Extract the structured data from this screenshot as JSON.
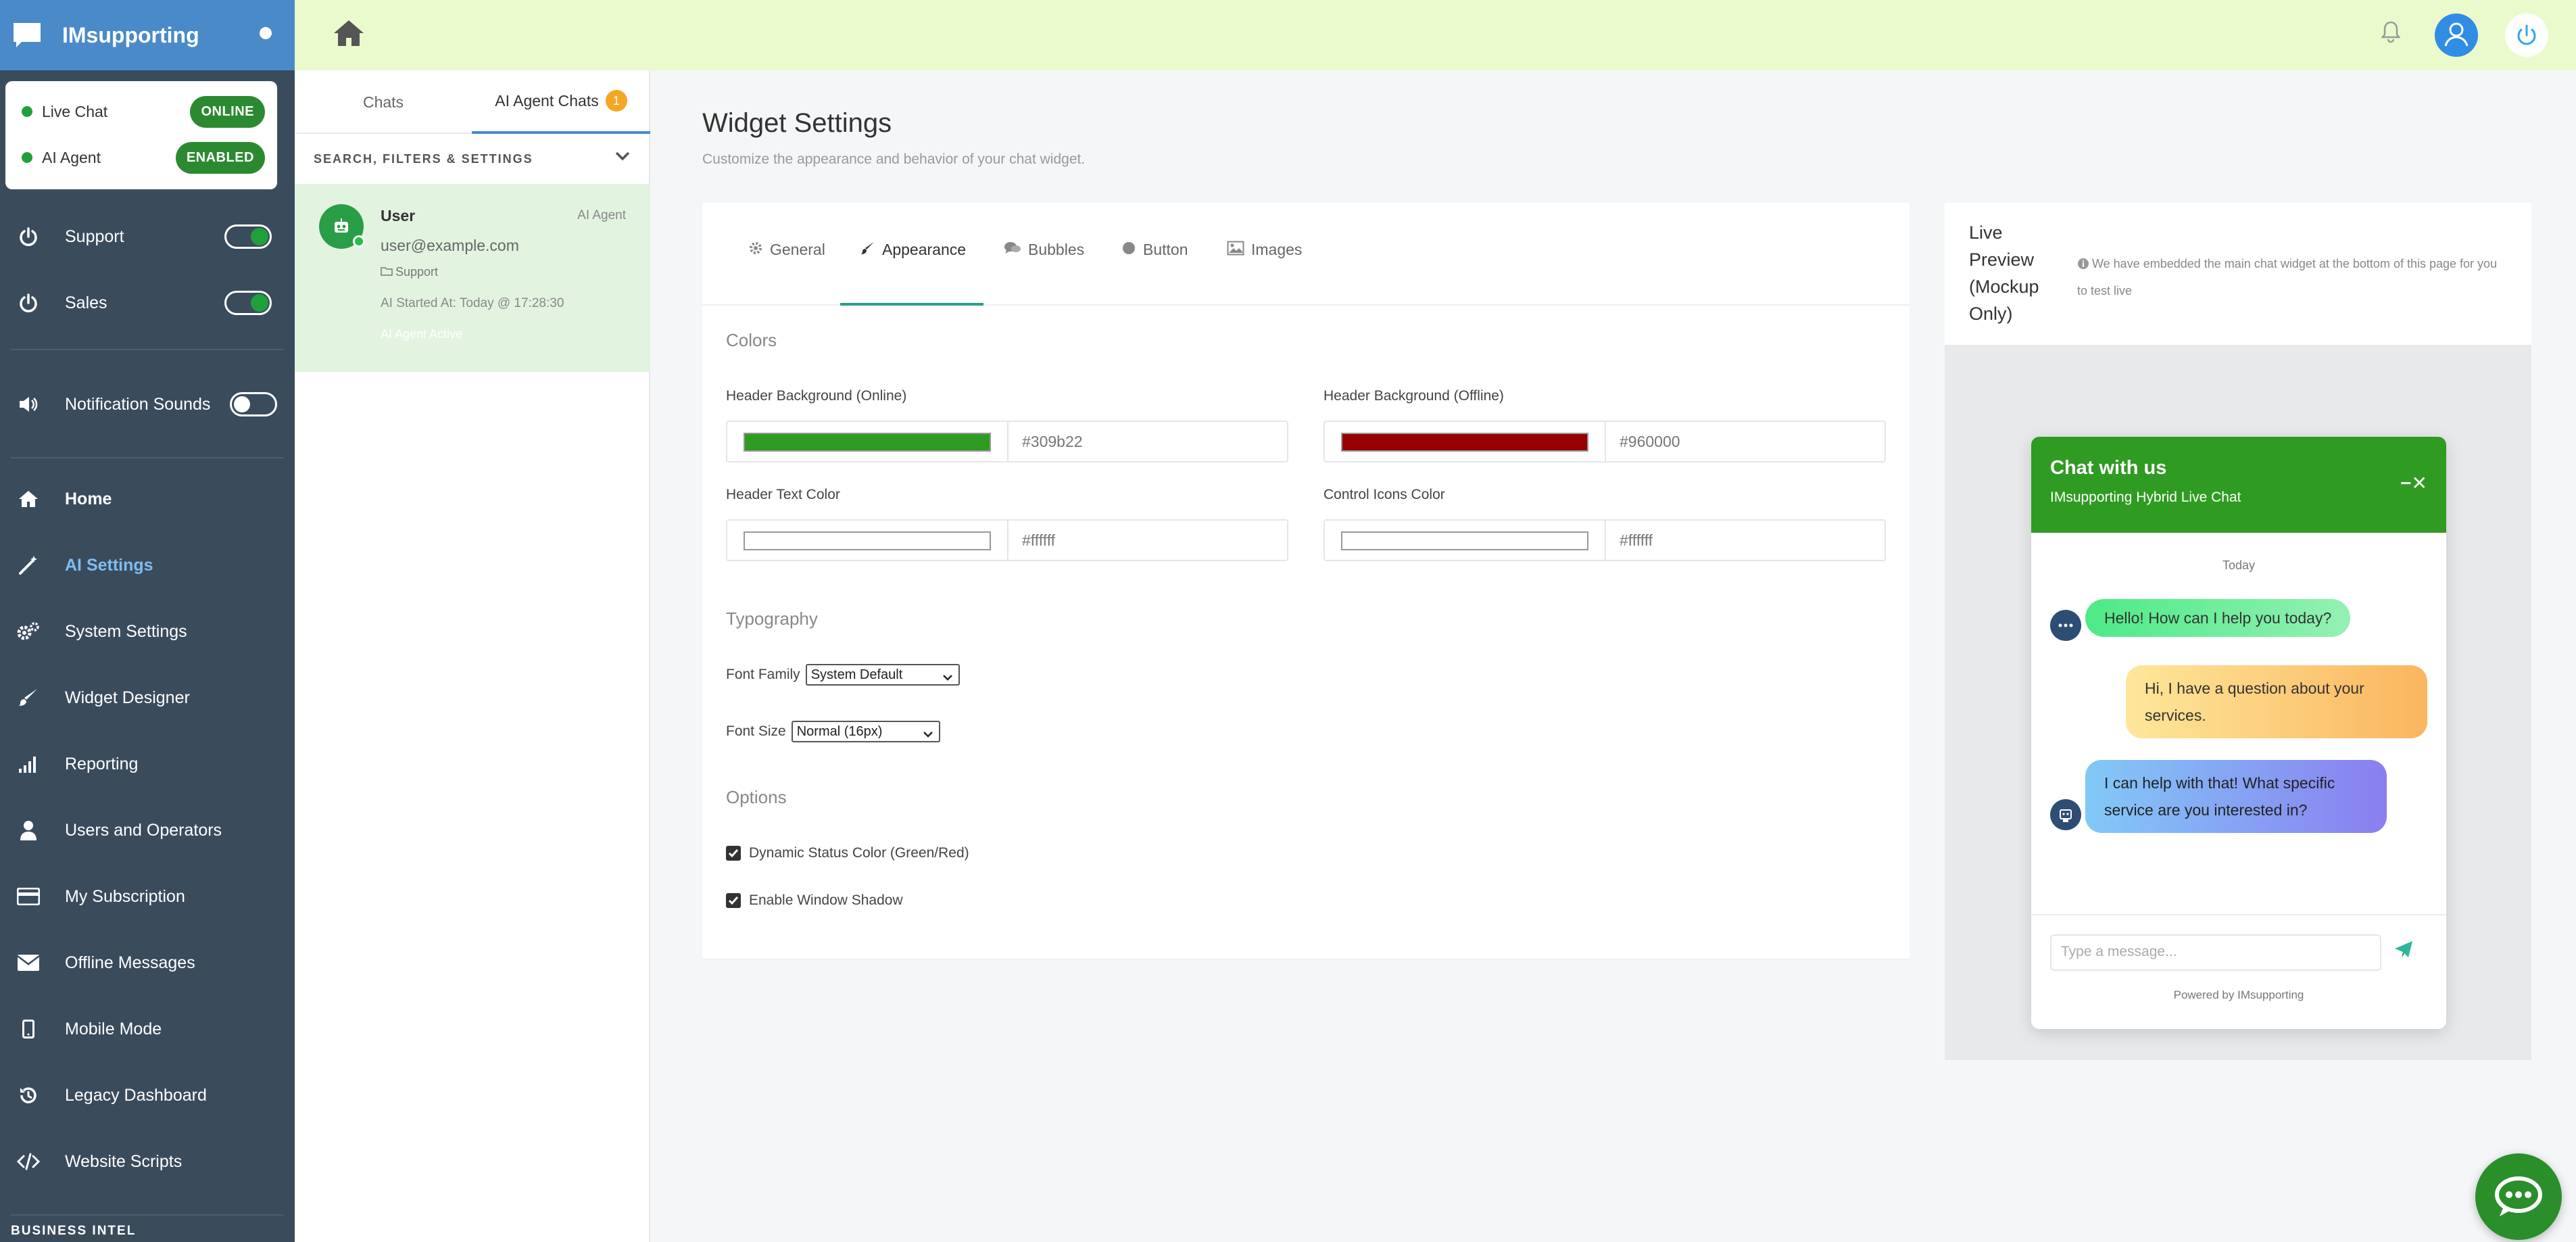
{
  "brand": {
    "name": "IMsupporting"
  },
  "status": {
    "live_chat": {
      "label": "Live Chat",
      "state": "ONLINE"
    },
    "ai_agent": {
      "label": "AI Agent",
      "state": "ENABLED"
    }
  },
  "sidebar": {
    "toggles": [
      {
        "label": "Support",
        "on": true
      },
      {
        "label": "Sales",
        "on": true
      },
      {
        "label": "Notification Sounds",
        "on": false
      }
    ],
    "items": [
      {
        "label": "Home",
        "icon": "home-icon"
      },
      {
        "label": "AI Settings",
        "icon": "magic-wand-icon",
        "active": true
      },
      {
        "label": "System Settings",
        "icon": "gears-icon"
      },
      {
        "label": "Widget Designer",
        "icon": "paintbrush-icon"
      },
      {
        "label": "Reporting",
        "icon": "bar-signal-icon"
      },
      {
        "label": "Users and Operators",
        "icon": "user-icon"
      },
      {
        "label": "My Subscription",
        "icon": "credit-card-icon"
      },
      {
        "label": "Offline Messages",
        "icon": "envelope-icon"
      },
      {
        "label": "Mobile Mode",
        "icon": "mobile-icon"
      },
      {
        "label": "Legacy Dashboard",
        "icon": "history-icon"
      },
      {
        "label": "Website Scripts",
        "icon": "code-icon"
      }
    ],
    "section_label": "BUSINESS INTEL"
  },
  "chat_panel": {
    "tabs": [
      {
        "label": "Chats"
      },
      {
        "label": "AI Agent Chats",
        "badge": "1"
      }
    ],
    "filters_label": "SEARCH, FILTERS & SETTINGS",
    "chat": {
      "name": "User",
      "tag": "AI Agent",
      "email": "user@example.com",
      "department": "Support",
      "started": "AI Started At: Today @ 17:28:30",
      "active": "AI Agent Active"
    }
  },
  "page": {
    "title": "Widget Settings",
    "subtitle": "Customize the appearance and behavior of your chat widget."
  },
  "settings": {
    "tabs": [
      "General",
      "Appearance",
      "Bubbles",
      "Button",
      "Images"
    ],
    "active_tab": "Appearance",
    "colors_heading": "Colors",
    "fields": [
      {
        "label": "Header Background (Online)",
        "value": "#309b22"
      },
      {
        "label": "Header Background (Offline)",
        "value": "#960000"
      },
      {
        "label": "Header Text Color",
        "value": "#ffffff"
      },
      {
        "label": "Control Icons Color",
        "value": "#ffffff"
      }
    ],
    "typography_heading": "Typography",
    "font_family_label": "Font Family",
    "font_family_value": "System Default",
    "font_size_label": "Font Size",
    "font_size_value": "Normal (16px)",
    "options_heading": "Options",
    "options": [
      {
        "label": "Dynamic Status Color (Green/Red)",
        "checked": true
      },
      {
        "label": "Enable Window Shadow",
        "checked": true
      }
    ]
  },
  "preview": {
    "title": "Live Preview (Mockup Only)",
    "note": "We have embedded the main chat widget at the bottom of this page for you to test live",
    "widget": {
      "title": "Chat with us",
      "subtitle": "IMsupporting Hybrid Live Chat",
      "controls": "−✕",
      "day": "Today",
      "messages": [
        {
          "from": "bot",
          "text": "Hello! How can I help you today?"
        },
        {
          "from": "user",
          "text": "Hi, I have a question about your services."
        },
        {
          "from": "bot",
          "text": "I can help with that! What specific service are you interested in?"
        }
      ],
      "input_placeholder": "Type a message...",
      "powered_by": "Powered by IMsupporting"
    }
  },
  "colors": {
    "sidebar": "#3a4b5c",
    "brand_bar": "#4a8ac8",
    "topbar": "#ebfacc",
    "online_green": "#309b22",
    "offline_red": "#960000"
  }
}
